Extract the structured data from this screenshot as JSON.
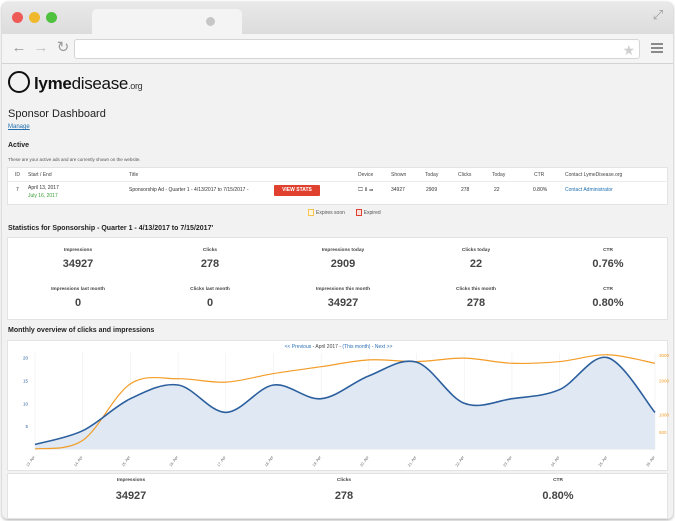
{
  "logo": {
    "brand_bold": "lyme",
    "brand_rest": "disease",
    "tld": ".org"
  },
  "page": {
    "title": "Sponsor Dashboard",
    "manage_link": "Manage",
    "active_heading": "Active",
    "active_note": "These are your active ads and are currently shown on the website."
  },
  "ads_table": {
    "headers": [
      "ID",
      "Start / End",
      "Title",
      "Device",
      "Shown",
      "Today",
      "Clicks",
      "Today",
      "CTR",
      "Contact LymeDisease.org"
    ],
    "row": {
      "id": "7",
      "start": "April 13, 2017",
      "end": "July 16, 2017",
      "title": "Sponsorship Ad - Quarter 1 - 4/13/2017 to 7/15/2017 -",
      "button": "VIEW STATS",
      "device_icons": "🖵 ▯ ▭",
      "shown": "34927",
      "today": "2909",
      "clicks": "278",
      "clicks_today": "22",
      "ctr": "0.80%",
      "contact": "Contact Administrator"
    },
    "legend": {
      "expires_soon": "Expires soon",
      "expired": "Expired",
      "expires_soon_color": "#f6c451",
      "expired_color": "#e0412f"
    }
  },
  "stats": {
    "heading": "Statistics for  Sponsorship  - Quarter 1 - 4/13/2017 to 7/15/2017'",
    "items": [
      {
        "label": "Impressions",
        "value": "34927"
      },
      {
        "label": "Clicks",
        "value": "278"
      },
      {
        "label": "Impressions today",
        "value": "2909"
      },
      {
        "label": "Clicks today",
        "value": "22"
      },
      {
        "label": "CTR",
        "value": "0.76%"
      },
      {
        "label": "Impressions last month",
        "value": "0"
      },
      {
        "label": "Clicks last month",
        "value": "0"
      },
      {
        "label": "Impressions this month",
        "value": "34927"
      },
      {
        "label": "Clicks this month",
        "value": "278"
      },
      {
        "label": "CTR",
        "value": "0.80%"
      }
    ]
  },
  "monthly": {
    "heading": "Monthly overview of clicks and impressions",
    "nav_prev": "<< Previous",
    "nav_month": " - April 2017 - ",
    "nav_this": "(This month)",
    "nav_sep": " - ",
    "nav_next": "Next >>"
  },
  "chart_data": {
    "type": "line",
    "x": [
      "13. Apr",
      "14. Apr",
      "15. Apr",
      "16. Apr",
      "17. Apr",
      "18. Apr",
      "19. Apr",
      "20. Apr",
      "21. Apr",
      "22. Apr",
      "23. Apr",
      "24. Apr",
      "25. Apr",
      "26. Apr"
    ],
    "series": [
      {
        "axis": "left",
        "color": "#2b5f9e",
        "values": [
          1,
          4,
          11,
          14,
          8,
          14,
          11,
          16,
          19,
          10,
          11,
          13,
          20,
          8
        ]
      },
      {
        "axis": "right",
        "color": "#f39c27",
        "values": [
          0,
          250,
          1900,
          2050,
          1950,
          2200,
          2400,
          2600,
          2550,
          2650,
          2500,
          2550,
          2750,
          2500
        ]
      }
    ],
    "left_ticks": [
      "20",
      "15",
      "10",
      "5"
    ],
    "right_ticks": [
      "3000",
      "2000",
      "1000",
      "500"
    ],
    "ylim_left": [
      0,
      21
    ],
    "ylim_right": [
      0,
      2800
    ],
    "fill_color": "#dfe8f3"
  },
  "bottom_stats": [
    {
      "label": "Impressions",
      "value": "34927"
    },
    {
      "label": "Clicks",
      "value": "278"
    },
    {
      "label": "CTR",
      "value": "0.80%"
    }
  ],
  "colors": {
    "accent_button": "#e0412f",
    "link": "#1f6fb0"
  }
}
